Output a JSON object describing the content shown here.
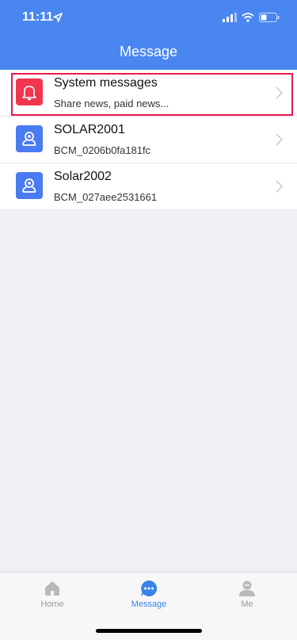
{
  "status_bar": {
    "time": "11:11"
  },
  "header": {
    "title": "Message"
  },
  "messages": [
    {
      "title": "System messages",
      "subtitle": "Share news, paid news...",
      "icon": "bell-icon",
      "icon_bg": "#f0364f"
    },
    {
      "title": "SOLAR2001",
      "subtitle": "BCM_0206b0fa181fc",
      "icon": "camera-user-icon",
      "icon_bg": "#4a7bf0"
    },
    {
      "title": "Solar2002",
      "subtitle": "BCM_027aee2531661",
      "icon": "camera-user-icon",
      "icon_bg": "#4a7bf0"
    }
  ],
  "tabbar": {
    "tabs": [
      {
        "label": "Home",
        "icon": "home-icon",
        "active": false
      },
      {
        "label": "Message",
        "icon": "chat-bubble-icon",
        "active": true
      },
      {
        "label": "Me",
        "icon": "person-icon",
        "active": false
      }
    ]
  },
  "colors": {
    "header": "#4a86f0",
    "active_tab": "#3b82e8",
    "highlight": "#e8194b"
  }
}
